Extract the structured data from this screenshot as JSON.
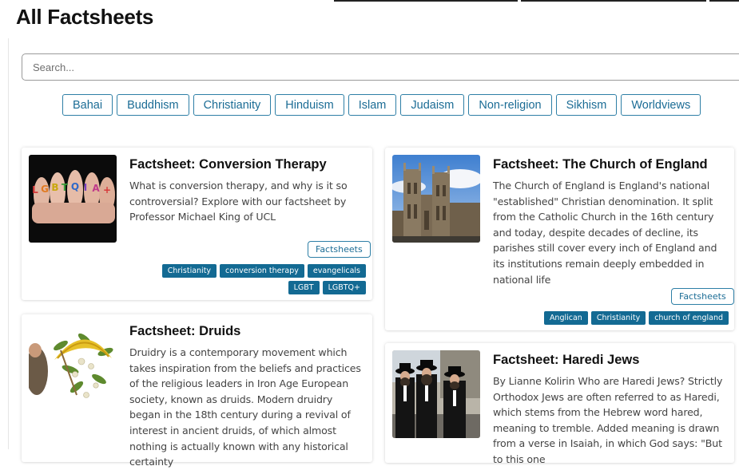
{
  "page": {
    "title": "All Factsheets",
    "search_placeholder": "Search..."
  },
  "filters": [
    "Bahai",
    "Buddhism",
    "Christianity",
    "Hinduism",
    "Islam",
    "Judaism",
    "Non-religion",
    "Sikhism",
    "Worldviews"
  ],
  "cards": [
    {
      "title": "Factsheet: Conversion Therapy",
      "description": "What is conversion therapy, and why is it so controversial? Explore with our factsheet by Professor Michael King of UCL",
      "thumb_letters": "LGBTQIA+",
      "type": "Factsheets",
      "tags": [
        "Christianity",
        "conversion therapy",
        "evangelicals",
        "LGBT",
        "LGBTQ+"
      ]
    },
    {
      "title": "Factsheet: The Church of England",
      "description": "The Church of England is England's national \"established\" Christian denomination. It split from the Catholic Church in the 16th century and today, despite decades of decline, its parishes still cover every inch of England and its institutions remain deeply embedded in national life",
      "type": "Factsheets",
      "tags": [
        "Anglican",
        "Christianity",
        "church of england"
      ]
    },
    {
      "title": "Factsheet: Druids",
      "description": "Druidry is a contemporary movement which takes inspiration from the beliefs and practices of the religious leaders in Iron Age European society, known as druids. Modern druidry began in the 18th century during a revival of interest in ancient druids, of which almost nothing is actually known with any historical certainty"
    },
    {
      "title": "Factsheet: Haredi Jews",
      "description": "By Lianne Kolirin Who are Haredi Jews?  Strictly Orthodox Jews are often referred to as Haredi, which stems from the Hebrew word hared, meaning to tremble. Added meaning is drawn from a verse in Isaiah, in which God says: \"But to this one"
    }
  ]
}
